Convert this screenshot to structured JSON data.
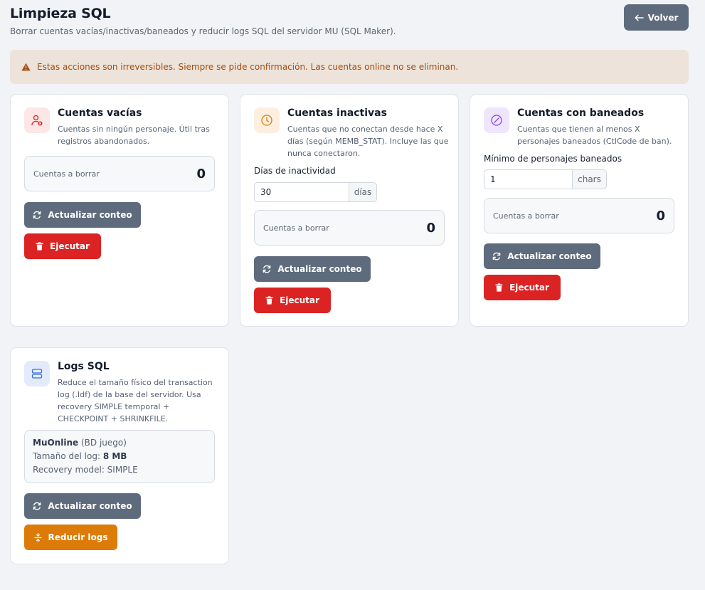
{
  "header": {
    "title": "Limpieza SQL",
    "subtitle": "Borrar cuentas vacías/inactivas/baneados y reducir logs SQL del servidor MU (SQL Maker).",
    "back_label": "Volver"
  },
  "alert": {
    "text": "Estas acciones son irreversibles. Siempre se pide confirmación. Las cuentas online no se eliminan.",
    "icon": "warning-icon",
    "color": "#a24d10"
  },
  "colors": {
    "accent_gray": "#5e6b7c",
    "danger": "#dc2323",
    "warning": "#dd7b08"
  },
  "cards": {
    "empty": {
      "title": "Cuentas vacías",
      "desc_lines": [
        "Cuentas sin ningún personaje. Útil tras",
        "registros abandonados."
      ],
      "count_label": "Cuentas a borrar",
      "count_value": "0",
      "refresh_label": "Actualizar conteo",
      "execute_label": "Ejecutar",
      "icon": "user-remove-icon"
    },
    "inactive": {
      "title": "Cuentas inactivas",
      "desc_lines": [
        "Cuentas que no conectan desde hace X",
        "días (según MEMB_STAT). Incluye las que",
        "nunca conectaron."
      ],
      "field_label": "Días de inactividad",
      "field_value": "30",
      "field_suffix": "días",
      "count_label": "Cuentas a borrar",
      "count_value": "0",
      "refresh_label": "Actualizar conteo",
      "execute_label": "Ejecutar",
      "icon": "clock-icon"
    },
    "banned": {
      "title": "Cuentas con baneados",
      "desc_lines": [
        "Cuentas que tienen al menos X",
        "personajes baneados (CtlCode de ban)."
      ],
      "field_label": "Mínimo de personajes baneados",
      "field_value": "1",
      "field_suffix": "chars",
      "count_label": "Cuentas a borrar",
      "count_value": "0",
      "refresh_label": "Actualizar conteo",
      "execute_label": "Ejecutar",
      "icon": "ban-icon"
    },
    "logs": {
      "title": "Logs SQL",
      "desc_lines": [
        "Reduce el tamaño físico del transaction",
        "log (.ldf) de la base del servidor. Usa",
        "recovery SIMPLE temporal +",
        "CHECKPOINT + SHRINKFILE."
      ],
      "db_name": "MuOnline",
      "db_note": "(BD juego)",
      "log_size_label": "Tamaño del log:",
      "log_size_value": "8 MB",
      "recovery_text": "Recovery model: SIMPLE",
      "refresh_label": "Actualizar conteo",
      "shrink_label": "Reducir logs",
      "icon": "server-icon"
    }
  }
}
